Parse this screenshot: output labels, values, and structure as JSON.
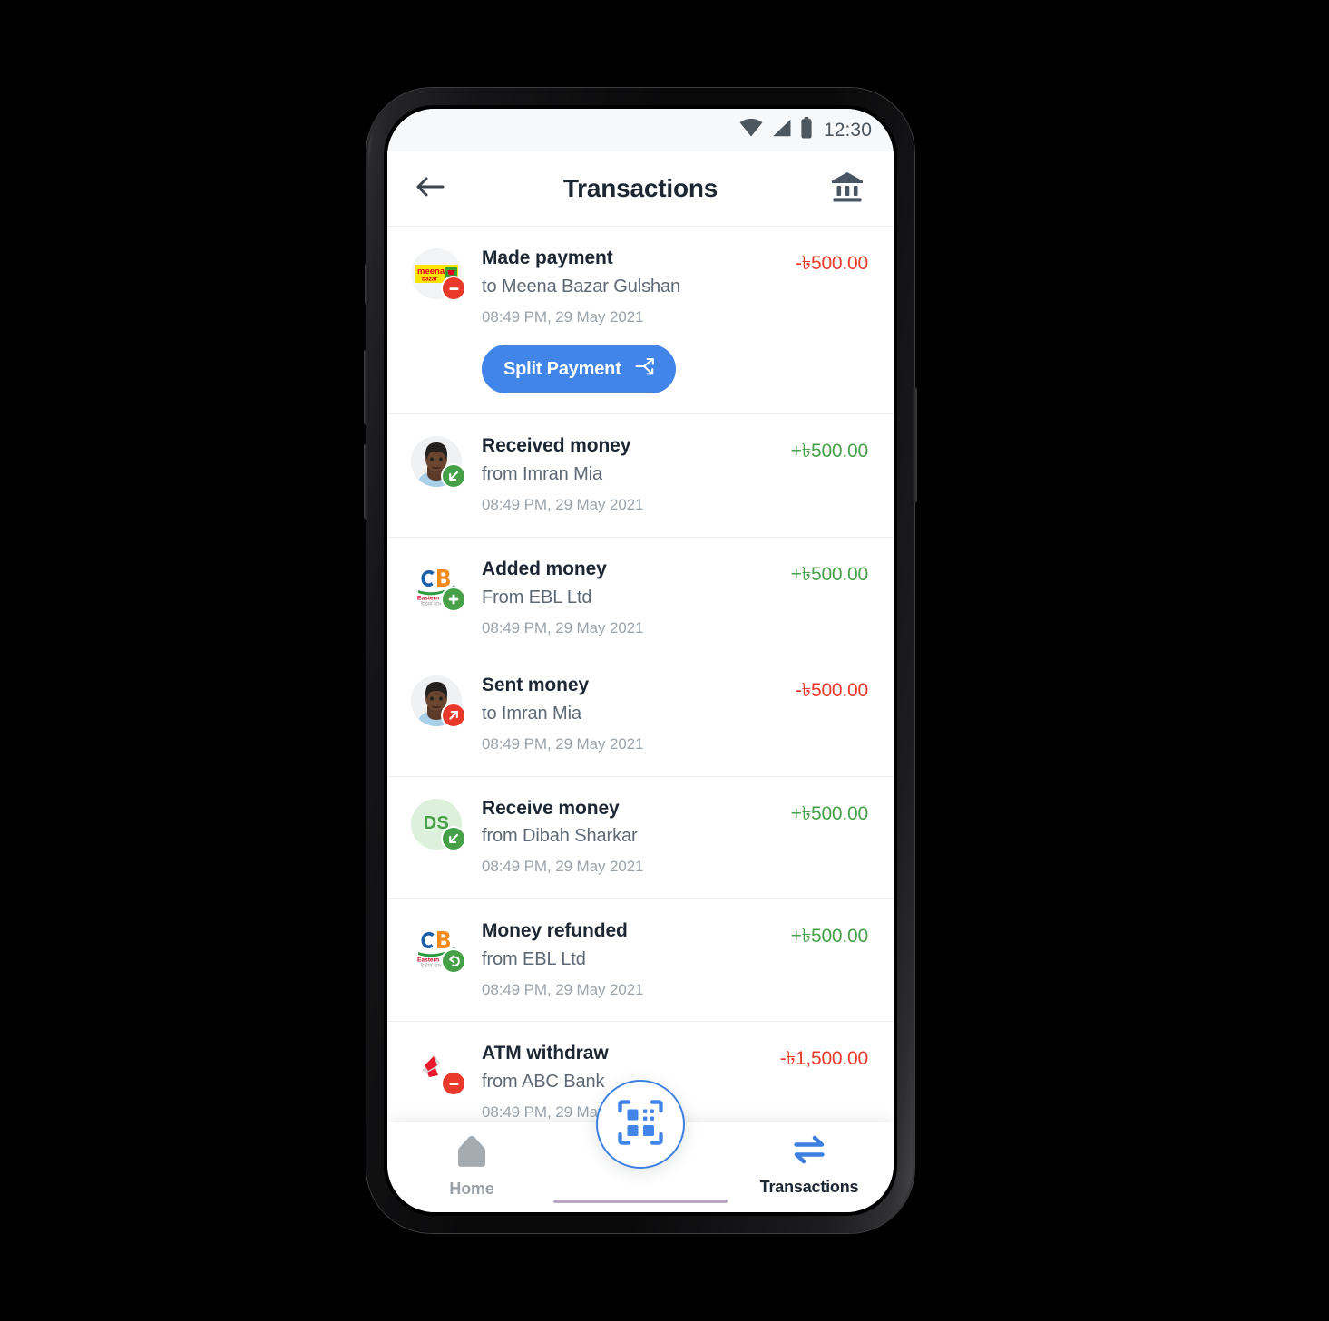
{
  "status_bar": {
    "time": "12:30",
    "icons": [
      "wifi-icon",
      "cellular-signal-icon",
      "battery-icon"
    ]
  },
  "app_bar": {
    "title": "Transactions",
    "back_icon": "back-arrow-icon",
    "bank_icon": "bank-icon"
  },
  "transactions": [
    {
      "title": "Made payment",
      "counterparty": "to Meena Bazar Gulshan",
      "timestamp": "08:49 PM, 29 May 2021",
      "amount": "-৳500.00",
      "direction": "negative",
      "avatar_type": "logo-meena-bazar",
      "badge_icon": "minus-icon",
      "action": {
        "label": "Split Payment",
        "icon": "split-arrow-icon"
      }
    },
    {
      "title": "Received money",
      "counterparty": "from Imran Mia",
      "timestamp": "08:49 PM, 29 May 2021",
      "amount": "+৳500.00",
      "direction": "positive",
      "avatar_type": "photo-person",
      "badge_icon": "arrow-down-left-icon"
    },
    {
      "title": "Added money",
      "counterparty": "From EBL Ltd",
      "timestamp": "08:49 PM, 29 May 2021",
      "amount": "+৳500.00",
      "direction": "positive",
      "avatar_type": "logo-ebl",
      "badge_icon": "plus-icon"
    },
    {
      "title": "Sent money",
      "counterparty": "to Imran Mia",
      "timestamp": "08:49 PM, 29 May 2021",
      "amount": "-৳500.00",
      "direction": "negative",
      "avatar_type": "photo-person",
      "badge_icon": "arrow-up-right-icon"
    },
    {
      "title": "Receive money",
      "counterparty": "from Dibah Sharkar",
      "timestamp": "08:49 PM, 29 May 2021",
      "amount": "+৳500.00",
      "direction": "positive",
      "avatar_type": "initials",
      "initials": "DS",
      "badge_icon": "arrow-down-left-icon"
    },
    {
      "title": "Money refunded",
      "counterparty": "from EBL Ltd",
      "timestamp": "08:49 PM, 29 May 2021",
      "amount": "+৳500.00",
      "direction": "positive",
      "avatar_type": "logo-ebl",
      "badge_icon": "refund-undo-icon"
    },
    {
      "title": "ATM withdraw",
      "counterparty": "from ABC Bank",
      "timestamp": "08:49 PM, 29 May 2021",
      "amount": "-৳1,500.00",
      "direction": "negative",
      "avatar_type": "logo-bank-red",
      "badge_icon": "minus-icon"
    }
  ],
  "bottom_nav": {
    "home": {
      "label": "Home",
      "icon": "home-icon",
      "active": false
    },
    "scan": {
      "icon": "qr-scan-icon"
    },
    "transactions": {
      "label": "Transactions",
      "icon": "transfer-arrows-icon",
      "active": true
    }
  },
  "colors": {
    "accent_blue": "#4285E8",
    "fab_border_blue": "#3C7FE0",
    "negative_red": "#E8392B",
    "positive_green": "#45A047",
    "title_dark": "#1D2733",
    "subtitle_gray": "#5D6873",
    "time_gray": "#9BA3AB",
    "status_bar_bg": "#F7F8F9"
  }
}
